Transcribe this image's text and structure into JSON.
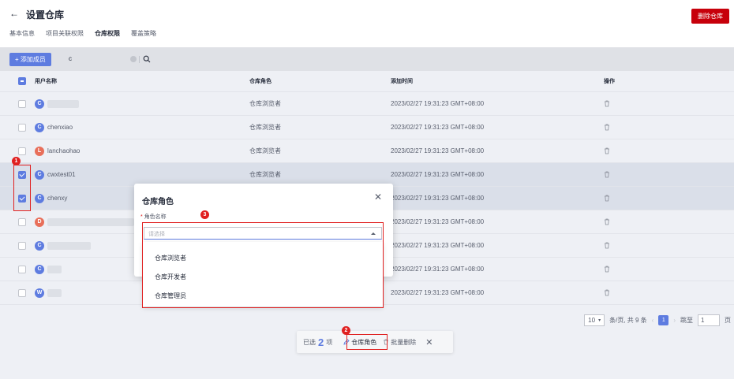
{
  "header": {
    "back_icon": "arrow-left-icon",
    "title": "设置仓库",
    "delete_repo": "删除仓库",
    "tabs": [
      {
        "label": "基本信息",
        "active": false
      },
      {
        "label": "项目关联权限",
        "active": false
      },
      {
        "label": "仓库权限",
        "active": true
      },
      {
        "label": "覆盖策略",
        "active": false
      }
    ]
  },
  "toolbar": {
    "add_member": "+ 添加成员",
    "search_value": "c"
  },
  "table": {
    "columns": [
      "用户名称",
      "仓库角色",
      "添加时间",
      "操作"
    ],
    "rows": [
      {
        "avatar": "C",
        "avatar_color": "#5e7ce0",
        "name": "",
        "role": "仓库浏览者",
        "time": "2023/02/27 19:31:23 GMT+08:00",
        "checked": false,
        "selected": false
      },
      {
        "avatar": "C",
        "avatar_color": "#5e7ce0",
        "name": "chenxiao",
        "role": "仓库浏览者",
        "time": "2023/02/27 19:31:23 GMT+08:00",
        "checked": false,
        "selected": false
      },
      {
        "avatar": "L",
        "avatar_color": "#e86f5a",
        "name": "lanchaohao",
        "role": "仓库浏览者",
        "time": "2023/02/27 19:31:23 GMT+08:00",
        "checked": false,
        "selected": false
      },
      {
        "avatar": "C",
        "avatar_color": "#5e7ce0",
        "name": "cwxtest01",
        "role": "仓库浏览者",
        "time": "2023/02/27 19:31:23 GMT+08:00",
        "checked": true,
        "selected": true
      },
      {
        "avatar": "C",
        "avatar_color": "#5e7ce0",
        "name": "chenxy",
        "role": "",
        "time": "2023/02/27 19:31:23 GMT+08:00",
        "checked": true,
        "selected": true
      },
      {
        "avatar": "D",
        "avatar_color": "#e86f5a",
        "name": "",
        "role": "",
        "time": "2023/02/27 19:31:23 GMT+08:00",
        "checked": false,
        "selected": false
      },
      {
        "avatar": "C",
        "avatar_color": "#5e7ce0",
        "name": "",
        "role": "",
        "time": "2023/02/27 19:31:23 GMT+08:00",
        "checked": false,
        "selected": false
      },
      {
        "avatar": "C",
        "avatar_color": "#5e7ce0",
        "name": "",
        "role": "",
        "time": "2023/02/27 19:31:23 GMT+08:00",
        "checked": false,
        "selected": false
      },
      {
        "avatar": "W",
        "avatar_color": "#5e7ce0",
        "name": "",
        "role": "",
        "time": "2023/02/27 19:31:23 GMT+08:00",
        "checked": false,
        "selected": false
      }
    ],
    "row_fragment": "2"
  },
  "pagination": {
    "page_size": "10",
    "total_text": "条/页, 共 9 条",
    "current_page": "1",
    "jump_label": "跳至",
    "jump_value": "1",
    "page_suffix": "页"
  },
  "batch_bar": {
    "selected_prefix": "已选",
    "selected_count": "2",
    "selected_suffix": "项",
    "role_action": "仓库角色",
    "delete_action": "批量删除"
  },
  "dialog": {
    "title": "仓库角色",
    "field_label": "角色名称",
    "placeholder": "请选择",
    "options": [
      "仓库浏览者",
      "仓库开发者",
      "仓库管理员"
    ]
  },
  "markers": [
    "1",
    "2",
    "3"
  ],
  "colors": {
    "accent": "#5e7ce0",
    "danger": "#c7000b",
    "marker": "#e02020"
  }
}
